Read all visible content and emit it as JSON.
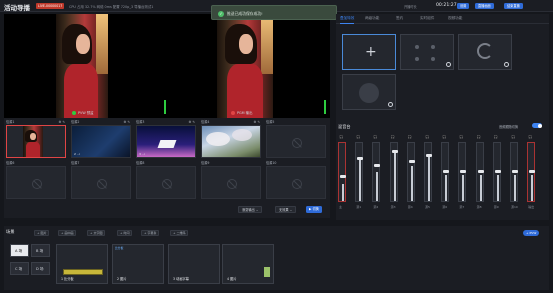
{
  "topbar": {
    "title": "活动导播",
    "live_badge": "LIVE-00000017",
    "stats": "CPU 占用 32.7%   网络 0ms   配置 720p_3   导播台测试1",
    "timer_label": "开播时长",
    "timer": "00:21:27",
    "buttons": [
      "设置",
      "直播画面",
      "结束直播"
    ]
  },
  "toast": {
    "text": "推送已成功保存成功!"
  },
  "preview": {
    "pvw_label": "PVW 预监",
    "pgm_label": "PGM 输出"
  },
  "sources": {
    "items": [
      {
        "label": "信源1",
        "sub": "",
        "type": "photo",
        "selected": true
      },
      {
        "label": "信源2",
        "sub": "2 ..i",
        "type": "dark"
      },
      {
        "label": "信源3",
        "sub": "3 ..i",
        "type": "slide"
      },
      {
        "label": "信源4",
        "sub": "4 ..i",
        "type": "blossom"
      },
      {
        "label": "信源5",
        "sub": "",
        "type": "empty"
      },
      {
        "label": "信源6",
        "sub": "",
        "type": "empty"
      },
      {
        "label": "信源7",
        "sub": "",
        "type": "empty"
      },
      {
        "label": "信源8",
        "sub": "",
        "type": "empty"
      },
      {
        "label": "信源9",
        "sub": "",
        "type": "empty"
      },
      {
        "label": "信源10",
        "sub": "",
        "type": "empty"
      }
    ],
    "switch_select": "渐变输出 ⌄",
    "duration_select": "无效果 ⌄",
    "push_button": "▶ 切换"
  },
  "rpanel": {
    "tabs": [
      "叠加特效",
      "两级功能",
      "签约",
      "实时组件",
      "视频功能"
    ],
    "active_tab": 0
  },
  "mixer": {
    "title": "混音台",
    "follow_label": "音频跟随切换",
    "follow_on": true,
    "channels": [
      {
        "label": "主",
        "level": 0.3,
        "knob": 0.42,
        "red": true
      },
      {
        "label": "源1",
        "level": 0.7,
        "knob": 0.75
      },
      {
        "label": "源2",
        "level": 0.5,
        "knob": 0.62
      },
      {
        "label": "源3",
        "level": 0.85,
        "knob": 0.88
      },
      {
        "label": "源4",
        "level": 0.6,
        "knob": 0.7
      },
      {
        "label": "源5",
        "level": 0.78,
        "knob": 0.8
      },
      {
        "label": "源6",
        "level": 0.45,
        "knob": 0.52
      },
      {
        "label": "源7",
        "level": 0.45,
        "knob": 0.52
      },
      {
        "label": "源8",
        "level": 0.45,
        "knob": 0.52
      },
      {
        "label": "源9",
        "level": 0.45,
        "knob": 0.52
      },
      {
        "label": "源10",
        "level": 0.45,
        "knob": 0.52
      },
      {
        "label": "输出",
        "level": 0.45,
        "knob": 0.52,
        "red": true
      }
    ]
  },
  "bottom": {
    "title": "场景",
    "scenes": [
      "A 场",
      "B 场",
      "C 场",
      "D 场"
    ],
    "active_scene": 0,
    "add_buttons": [
      "+ 图片",
      "+ 画中画",
      "+ 文字图",
      "+ 时间",
      "+ 字幕条",
      "+ 二维码"
    ],
    "layers": [
      {
        "name": "1 比分板",
        "tag": ""
      },
      {
        "name": "2 图片",
        "tag": "比分板"
      },
      {
        "name": "3 动画字幕",
        "tag": ""
      },
      {
        "name": "4 图片",
        "tag": ""
      }
    ],
    "pvw_button": "+ PVW"
  },
  "colors": {
    "accent": "#2f6bd8",
    "live": "#c0392b",
    "success": "#4fbf6a",
    "meter": "#2ecc40"
  }
}
